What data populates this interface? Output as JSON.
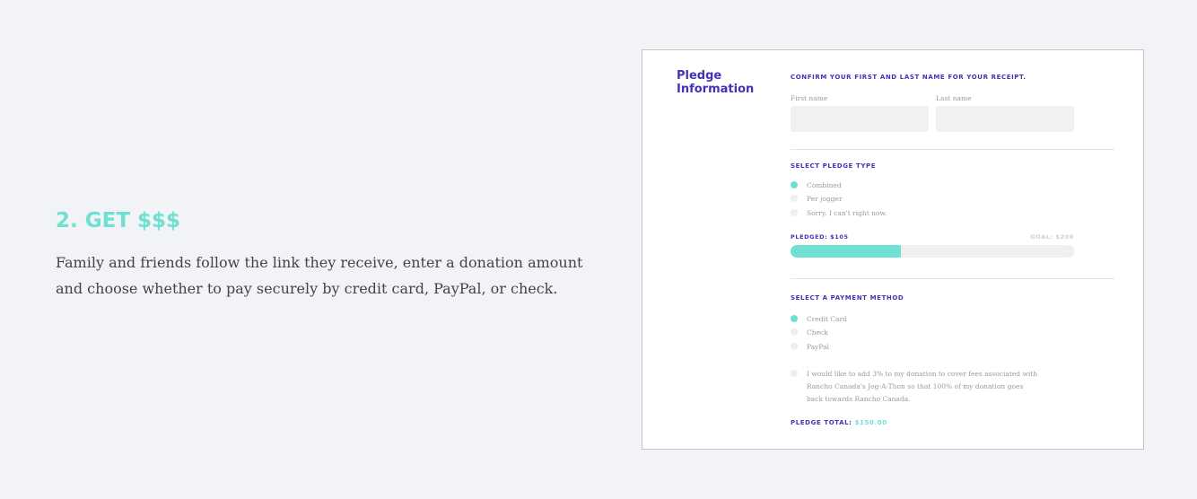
{
  "step": {
    "title": "2. GET $$$",
    "description": "Family and friends follow the link they receive, enter a donation amount and choose whether to pay securely by credit card, PayPal, or check."
  },
  "form": {
    "heading": "Pledge Information",
    "name_section": {
      "label": "CONFIRM YOUR FIRST AND LAST NAME FOR YOUR RECEIPT.",
      "first_name_label": "First name",
      "first_name_value": "",
      "last_name_label": "Last name",
      "last_name_value": ""
    },
    "pledge_type": {
      "label": "SELECT PLEDGE TYPE",
      "options": [
        "Combined",
        "Per jogger",
        "Sorry, I can't right now."
      ],
      "selected": "Combined"
    },
    "progress": {
      "pledged_label": "PLEDGED: $105",
      "goal_label": "GOAL: $200",
      "fill_fraction": 0.39
    },
    "payment": {
      "label": "SELECT A PAYMENT METHOD",
      "options": [
        "Credit Card",
        "Check",
        "PayPal"
      ],
      "selected": "Credit Card"
    },
    "fees_option": {
      "text": "I would like to add 3% to my donation to cover fees associated with Rancho Canada's Jog-A-Thon so that 100% of my donation goes back towards Rancho Canada.",
      "checked": false
    },
    "total": {
      "label": "PLEDGE TOTAL:",
      "amount": "$150.00"
    }
  },
  "colors": {
    "accent_teal": "#6fe0d2",
    "brand_purple": "#4233b8",
    "background": "#f2f3f7",
    "body_text": "#444444"
  }
}
